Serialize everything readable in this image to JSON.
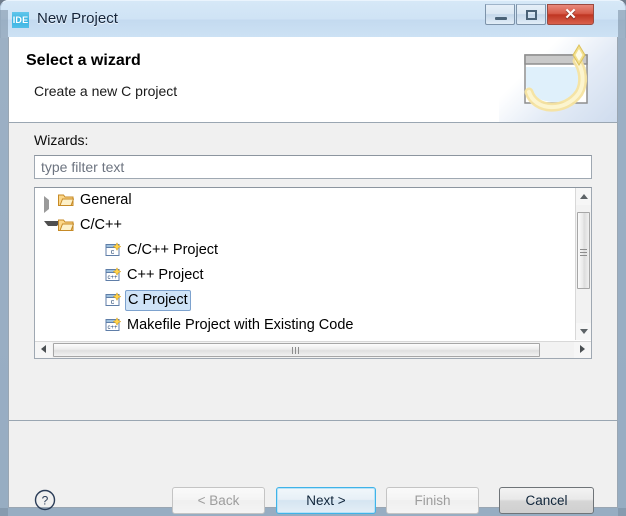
{
  "window": {
    "title": "New Project",
    "icon": "ide-icon",
    "icon_text": "IDE",
    "controls": {
      "minimize": "minimize-icon",
      "maximize": "maximize-icon",
      "close": "✕"
    }
  },
  "header": {
    "title": "Select a wizard",
    "description": "Create a new C project",
    "banner_icon": "wizard-window-sparkle-icon"
  },
  "body": {
    "wizards_label": "Wizards:",
    "filter": {
      "value": "",
      "placeholder": "type filter text"
    },
    "tree": [
      {
        "label": "General",
        "level": 0,
        "icon": "folder-icon",
        "twisty": "collapsed",
        "selected": false
      },
      {
        "label": "C/C++",
        "level": 0,
        "icon": "folder-icon",
        "twisty": "expanded",
        "selected": false
      },
      {
        "label": "C/C++ Project",
        "level": 1,
        "icon": "c-project-icon",
        "twisty": "none",
        "selected": false
      },
      {
        "label": "C++ Project",
        "level": 1,
        "icon": "cpp-project-icon",
        "twisty": "none",
        "selected": false
      },
      {
        "label": "C Project",
        "level": 1,
        "icon": "c-project-icon",
        "twisty": "none",
        "selected": true
      },
      {
        "label": "Makefile Project with Existing Code",
        "level": 1,
        "icon": "cpp-project-icon",
        "twisty": "none",
        "selected": false
      }
    ],
    "scrollbars": {
      "vertical": "vertical-scrollbar",
      "horizontal": "horizontal-scrollbar"
    }
  },
  "footer": {
    "help": "?",
    "buttons": [
      {
        "id": "back",
        "label": "< Back",
        "state": "disabled"
      },
      {
        "id": "next",
        "label": "Next >",
        "state": "default"
      },
      {
        "id": "finish",
        "label": "Finish",
        "state": "disabled"
      },
      {
        "id": "cancel",
        "label": "Cancel",
        "state": "hover"
      }
    ]
  },
  "colors": {
    "titlebar": "#cfe3f5",
    "accent": "#3fb3e8",
    "selection_fill": "#cfe3f7",
    "selection_border": "#7da2ce",
    "close_button": "#bf3522",
    "folder": "#e8a33d",
    "dialog_bg": "#f0f0f0"
  }
}
